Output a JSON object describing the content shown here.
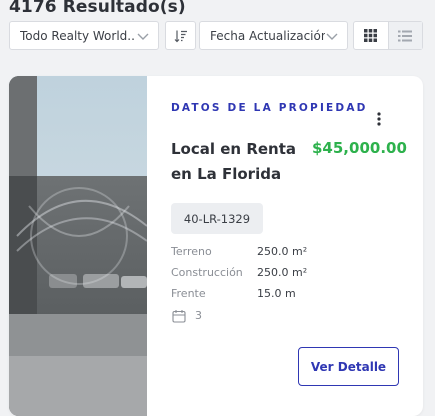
{
  "header": {
    "results_count": "4176 Resultado(s)"
  },
  "filters": {
    "agency_select": {
      "value": "Todo Realty World..."
    },
    "sort_button": {
      "icon": "sort-icon"
    },
    "order_select": {
      "value": "Fecha Actualización"
    },
    "view_toggle": {
      "grid_icon": "grid-icon",
      "list_icon": "list-icon",
      "active": "grid"
    }
  },
  "listing": {
    "section_label": "DATOS DE LA PROPIEDAD",
    "title_line1": "Local en Renta",
    "title_line2": "en La Florida",
    "price": "$45,000.00",
    "code": "40-LR-1329",
    "specs": [
      {
        "label": "Terreno",
        "value": "250.0 m²"
      },
      {
        "label": "Construcción",
        "value": "250.0 m²"
      },
      {
        "label": "Frente",
        "value": "15.0 m"
      }
    ],
    "calendar_count": "3",
    "detail_button": "Ver Detalle"
  },
  "colors": {
    "accent": "#2f37b3",
    "price": "#2db14c",
    "background": "#f1f2f4"
  }
}
